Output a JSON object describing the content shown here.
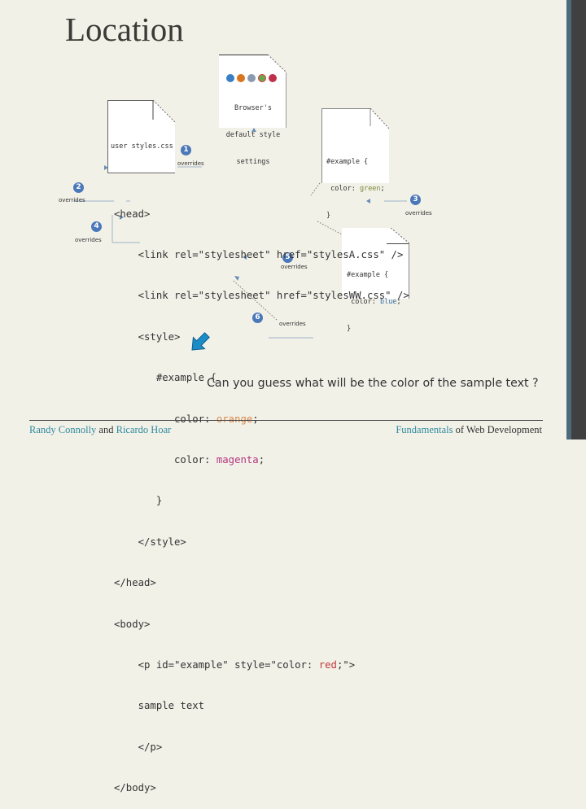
{
  "slide": {
    "title": "Location",
    "question": "Can you guess what will be the color of the sample text ?"
  },
  "docs": {
    "browser": {
      "lines": [
        "Browser's",
        "default style",
        "settings"
      ],
      "browser_icons": [
        "ie-icon",
        "firefox-icon",
        "safari-icon",
        "chrome-icon",
        "opera-icon"
      ]
    },
    "user": {
      "label": "user styles.css"
    },
    "stylesA": {
      "line1": "#example {",
      "line2_prefix": " color: ",
      "line2_value": "green",
      "line2_suffix": ";",
      "line3": "}"
    },
    "stylesWW": {
      "line1": "#example {",
      "line2_prefix": " color: ",
      "line2_value": "blue",
      "line2_suffix": ";",
      "line3": "}"
    }
  },
  "code": {
    "head_open": "<head>",
    "link1": "    <link rel=\"stylesheet\" href=\"stylesA.css\" />",
    "link2": "    <link rel=\"stylesheet\" href=\"stylesWW.css\" />",
    "style_open": "    <style>",
    "selector": "       #example {",
    "color1_prefix": "          color: ",
    "color1_value": "orange",
    "color1_suffix": ";",
    "color2_prefix": "          color: ",
    "color2_value": "magenta",
    "color2_suffix": ";",
    "brace_close": "       }",
    "style_close": "    </style>",
    "head_close": "</head>",
    "body_open": "<body>",
    "p_prefix": "    <p id=\"example\" style=\"color: ",
    "p_value": "red",
    "p_suffix": ";\">",
    "sample": "    sample text",
    "p_close": "    </p>",
    "body_close": "</body>"
  },
  "badges": [
    {
      "number": "1",
      "label": "overrides"
    },
    {
      "number": "2",
      "label": "overrides"
    },
    {
      "number": "3",
      "label": "overrides"
    },
    {
      "number": "4",
      "label": "overrides"
    },
    {
      "number": "5",
      "label": "overrides"
    },
    {
      "number": "6",
      "label": "overrides"
    }
  ],
  "footer": {
    "author1": "Randy Connolly",
    "and": " and ",
    "author2": "Ricardo Hoar",
    "book_highlight": "Fundamentals",
    "book_rest": " of Web Development"
  },
  "colors": {
    "background": "#f2f1e8",
    "badge": "#4b78b9",
    "arrow": "#1b8cc6",
    "accent_teal": "#2f8a9e"
  }
}
